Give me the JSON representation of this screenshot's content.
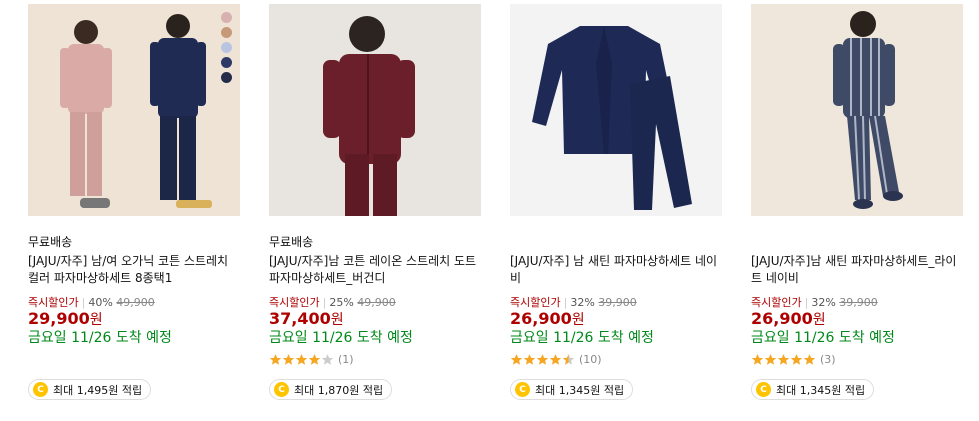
{
  "products": [
    {
      "shipping": "무료배송",
      "brand": "[JAJU/자주]",
      "name": " 남/여 오가닉 코튼 스트레치 컬러 파자마상하세트 8종택1",
      "discount_label": "즉시할인가",
      "discount_rate": "40%",
      "original_price": "49,900",
      "price": "29,900",
      "currency": "원",
      "arrival": "금요일 11/26 도착 예정",
      "rating": null,
      "review_count": null,
      "reward": "최대 1,495원 적립",
      "swatches": [
        "#d7b0b0",
        "#c69a78",
        "#b9c4e0",
        "#2e3a66",
        "#242c4a"
      ]
    },
    {
      "shipping": "무료배송",
      "brand": "[JAJU/자주]",
      "name": "남 코튼 레이온 스트레치 도트 파자마상하세트_버건디",
      "discount_label": "즉시할인가",
      "discount_rate": "25%",
      "original_price": "49,900",
      "price": "37,400",
      "currency": "원",
      "arrival": "금요일 11/26 도착 예정",
      "rating": 4,
      "review_count": "(1)",
      "reward": "최대 1,870원 적립",
      "swatches": []
    },
    {
      "shipping": "",
      "brand": "[JAJU/자주]",
      "name": " 남 새틴 파자마상하세트 네이비",
      "discount_label": "즉시할인가",
      "discount_rate": "32%",
      "original_price": "39,900",
      "price": "26,900",
      "currency": "원",
      "arrival": "금요일 11/26 도착 예정",
      "rating": 4.5,
      "review_count": "(10)",
      "reward": "최대 1,345원 적립",
      "swatches": []
    },
    {
      "shipping": "",
      "brand": "[JAJU/자주]",
      "name": "남 새틴 파자마상하세트_라이트 네이비",
      "discount_label": "즉시할인가",
      "discount_rate": "32%",
      "original_price": "39,900",
      "price": "26,900",
      "currency": "원",
      "arrival": "금요일 11/26 도착 예정",
      "rating": 5,
      "review_count": "(3)",
      "reward": "최대 1,345원 적립",
      "swatches": []
    }
  ],
  "coin_symbol": "C",
  "colors": {
    "price_red": "#ae0000",
    "arrival_green": "#00891a",
    "star_gold": "#f5a623",
    "coin_yellow": "#ffc400"
  }
}
